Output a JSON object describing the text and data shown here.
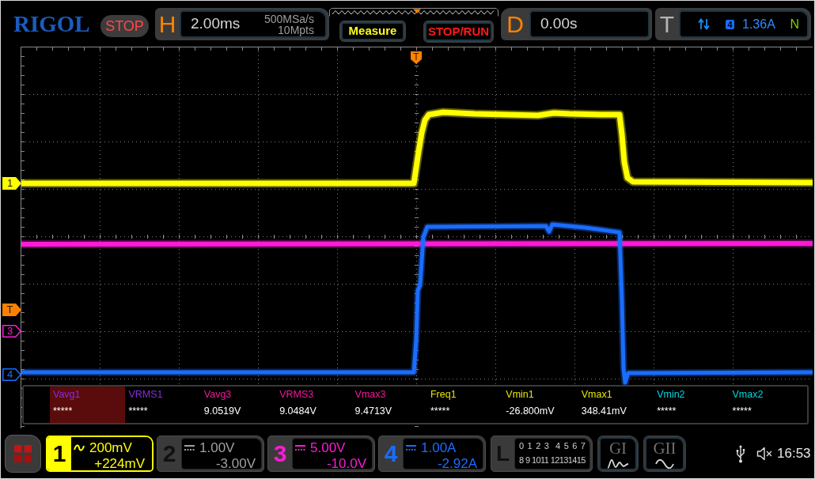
{
  "header": {
    "logo": "RIGOL",
    "run_state": "STOP",
    "horizontal": {
      "letter": "H",
      "timebase": "2.00ms",
      "sample_rate": "500MSa/s",
      "memory_depth": "10Mpts"
    },
    "buttons": [
      {
        "label": "Measure",
        "kind": "measure"
      },
      {
        "label": "STOP/RUN",
        "kind": "run_stop"
      }
    ],
    "delay": {
      "letter": "D",
      "value": "0.00s"
    },
    "trigger": {
      "letter": "T",
      "rising_edge": true,
      "falling_edge": true,
      "source": "4",
      "trigger_level": "1.36A",
      "sweep": "N"
    }
  },
  "display": {
    "trigger_marker": "T",
    "markers": [
      {
        "label": "1",
        "kind": "filled",
        "color": "#ffff00"
      },
      {
        "label": "T",
        "kind": "filled",
        "color": "#ff8000"
      },
      {
        "label": "3",
        "kind": "outline",
        "color": "#ff1ad9"
      },
      {
        "label": "4",
        "kind": "outline",
        "color": "#1a6dff"
      }
    ]
  },
  "measurements": [
    {
      "label": "Vavg1",
      "value": "*****",
      "color": "#8b2be2",
      "selected": true
    },
    {
      "label": "VRMS1",
      "value": "*****",
      "color": "#8b2be2",
      "selected": false
    },
    {
      "label": "Vavg3",
      "value": "9.0519V",
      "color": "#f0189c",
      "selected": false
    },
    {
      "label": "VRMS3",
      "value": "9.0484V",
      "color": "#f0189c",
      "selected": false
    },
    {
      "label": "Vmax3",
      "value": "9.4713V",
      "color": "#f0189c",
      "selected": false
    },
    {
      "label": "Freq1",
      "value": "*****",
      "color": "#e6e600",
      "selected": false
    },
    {
      "label": "Vmin1",
      "value": "-26.800mV",
      "color": "#e6e600",
      "selected": false
    },
    {
      "label": "Vmax1",
      "value": "348.41mV",
      "color": "#e6e600",
      "selected": false
    },
    {
      "label": "Vmin2",
      "value": "*****",
      "color": "#00d6e0",
      "selected": false
    },
    {
      "label": "Vmax2",
      "value": "*****",
      "color": "#00d6e0",
      "selected": false
    }
  ],
  "channels": [
    {
      "number": "1",
      "on": true,
      "selected": true,
      "ac_coupled": true,
      "scale": "200mV",
      "offset": "+224mV",
      "color": "#ffff00"
    },
    {
      "number": "2",
      "on": false,
      "selected": false,
      "ac_coupled": false,
      "scale": "1.00V",
      "offset": "-3.00V"
    },
    {
      "number": "3",
      "on": true,
      "selected": false,
      "ac_coupled": false,
      "scale": "5.00V",
      "offset": "-10.0V",
      "color": "#ff1ad9"
    },
    {
      "number": "4",
      "on": true,
      "selected": false,
      "ac_coupled": false,
      "scale": "1.00A",
      "offset": "-2.92A",
      "color": "#1a6dff"
    }
  ],
  "logic": {
    "letter": "L",
    "rows": [
      "0 1 2 3  4 5 6 7",
      "8 9 1011 12131415"
    ]
  },
  "generators": [
    {
      "label": "GI",
      "kind": "modulated"
    },
    {
      "label": "GII",
      "kind": "sine"
    }
  ],
  "status": {
    "muted": true,
    "time": "16:53"
  }
}
